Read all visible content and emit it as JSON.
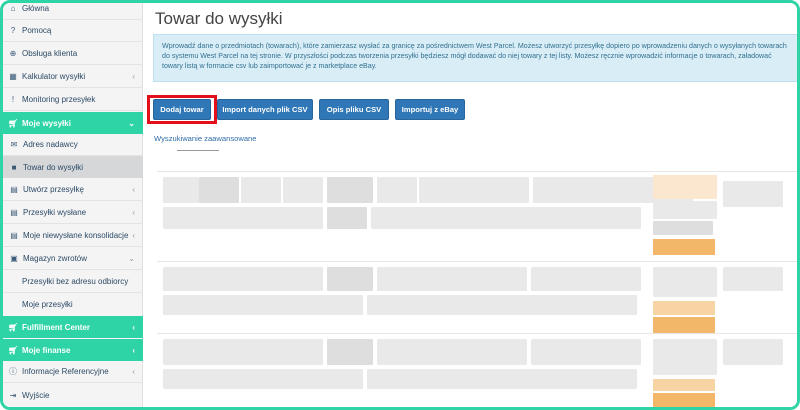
{
  "sidebar": {
    "items": [
      {
        "label": "Główna",
        "icon": "home-icon"
      },
      {
        "label": "Pomocą",
        "icon": "question-icon"
      },
      {
        "label": "Obsługa klienta",
        "icon": "lifebuoy-icon"
      },
      {
        "label": "Kalkulator wysyłki",
        "icon": "calculator-icon"
      },
      {
        "label": "Monitoring przesyłek",
        "icon": "alert-icon"
      },
      {
        "label": "Moje wysyłki",
        "icon": "cart-icon"
      },
      {
        "label": "Adres nadawcy",
        "icon": "envelope-icon"
      },
      {
        "label": "Towar do wysyłki",
        "icon": "box-icon"
      },
      {
        "label": "Utwórz przesyłkę",
        "icon": "list-icon"
      },
      {
        "label": "Przesyłki wysłane",
        "icon": "list-icon"
      },
      {
        "label": "Moje niewysłane konsolidacje",
        "icon": "list-icon"
      },
      {
        "label": "Magazyn zwrotów",
        "icon": "archive-icon"
      },
      {
        "label": "Przesyłki bez adresu odbiorcy",
        "icon": ""
      },
      {
        "label": "Moje przesyłki",
        "icon": ""
      },
      {
        "label": "Fulfillment Center",
        "icon": "cart-icon"
      },
      {
        "label": "Moje finanse",
        "icon": "cart-icon"
      },
      {
        "label": "Informacje Referencyjne",
        "icon": "info-icon"
      },
      {
        "label": "Wyjście",
        "icon": "exit-icon"
      }
    ]
  },
  "main": {
    "title": "Towar do wysyłki",
    "info_text": "Wprowadź dane o przedmiotach (towarach), które zamierzasz wysłać za granicę za pośrednictwem West Parcel. Możesz utworzyć przesyłkę dopiero po wprowadzeniu danych o wysyłanych towarach do systemu West Parcel na tej stronie. W przyszłości podczas tworzenia przesyłki będziesz mógł dodawać do niej towary z tej listy. Możesz ręcznie wprowadzić informacje o towarach, załadować towary listą w formacie csv lub zaimportować je z marketplace eBay.",
    "buttons": {
      "add": "Dodaj towar",
      "import_csv": "Import danych plik CSV",
      "csv_desc": "Opis pliku CSV",
      "ebay": "Importuj z eBay"
    },
    "advanced_search": "Wyszukiwanie zaawansowane"
  },
  "colors": {
    "accent": "#2ed3a6",
    "button": "#2f77b6",
    "highlight": "#e3101b",
    "info_bg": "#d9edf7"
  }
}
